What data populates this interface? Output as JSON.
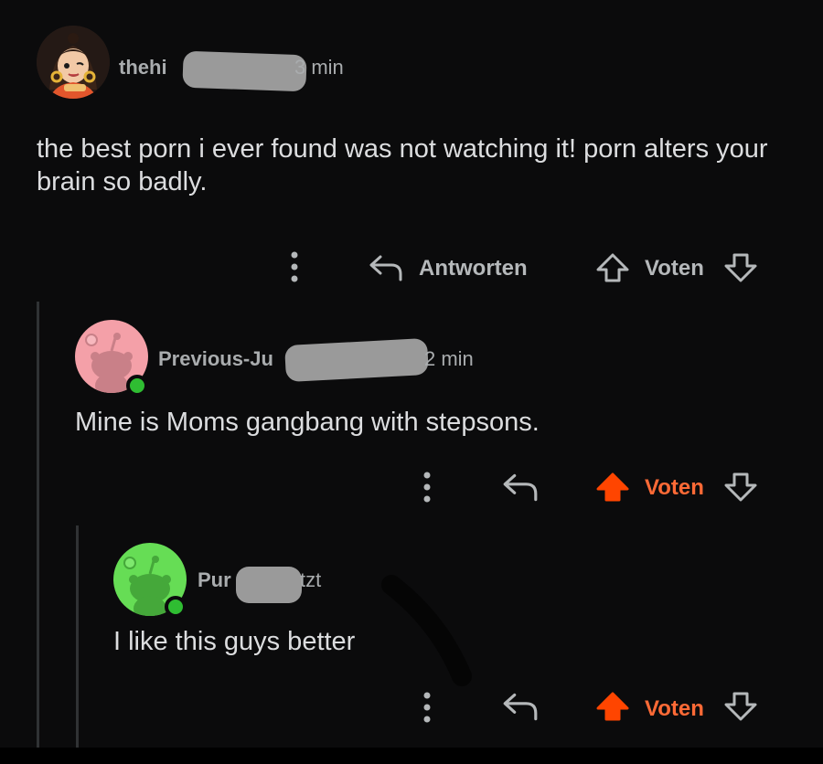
{
  "comments": [
    {
      "username": "thehi",
      "time": "3 min",
      "text": "the best porn i ever found was not watching it! porn alters your brain so badly.",
      "reply_label": "Antworten",
      "vote_label": "Voten"
    },
    {
      "username": "Previous-Ju",
      "time": "2 min",
      "text": "Mine is Moms gangbang with stepsons.",
      "vote_label": "Voten"
    },
    {
      "username": "Pur",
      "time": "tzt",
      "text": "I like this guys better",
      "vote_label": "Voten"
    }
  ],
  "colors": {
    "background": "#0b0b0c",
    "upvote_active": "#ff4500",
    "vote_active_label": "#ff6a36",
    "online": "#2fbd32",
    "avatar_pink": "#f4a0a8",
    "avatar_green": "#66dd55"
  },
  "icons": [
    "more-vertical-icon",
    "reply-arrow-icon",
    "upvote-arrow-icon",
    "downvote-arrow-icon",
    "snoo-avatar-icon",
    "online-status-icon"
  ]
}
